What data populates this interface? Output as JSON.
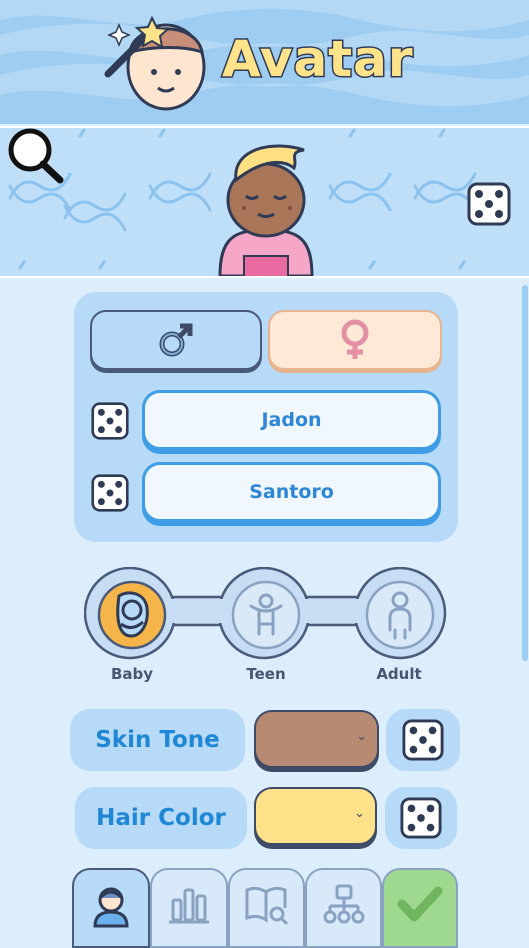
{
  "header": {
    "title": "Avatar",
    "logo_icon": "avatar-magic-wand-icon"
  },
  "preview": {
    "search_icon": "magnifier-icon",
    "randomize_icon": "dice-icon",
    "avatar": {
      "age": "baby",
      "skin": "#a9765a",
      "hair": "#ffe085",
      "shirt": "#f6a6c6"
    }
  },
  "identity": {
    "gender_options": [
      {
        "name": "male",
        "icon": "male-symbol-icon",
        "selected": true
      },
      {
        "name": "female",
        "icon": "female-symbol-icon",
        "selected": false
      }
    ],
    "first_name": "Jadon",
    "last_name": "Santoro"
  },
  "age_stages": [
    {
      "label": "Baby",
      "selected": true
    },
    {
      "label": "Teen",
      "selected": false
    },
    {
      "label": "Adult",
      "selected": false
    }
  ],
  "appearance": {
    "skin_tone": {
      "label": "Skin Tone",
      "value": "#b78a73"
    },
    "hair_color": {
      "label": "Hair Color",
      "value": "#ffe189"
    }
  },
  "tabs": [
    {
      "icon": "person-icon",
      "active": true
    },
    {
      "icon": "bar-chart-icon",
      "active": false
    },
    {
      "icon": "book-search-icon",
      "active": false
    },
    {
      "icon": "family-tree-icon",
      "active": false
    },
    {
      "icon": "checkmark-icon",
      "active": false
    }
  ],
  "colors": {
    "accent_blue": "#1f87d6",
    "panel": "#b6daf7",
    "background": "#dcedfc",
    "confirm_green": "#9fd88f",
    "age_selected": "#f5b548"
  }
}
